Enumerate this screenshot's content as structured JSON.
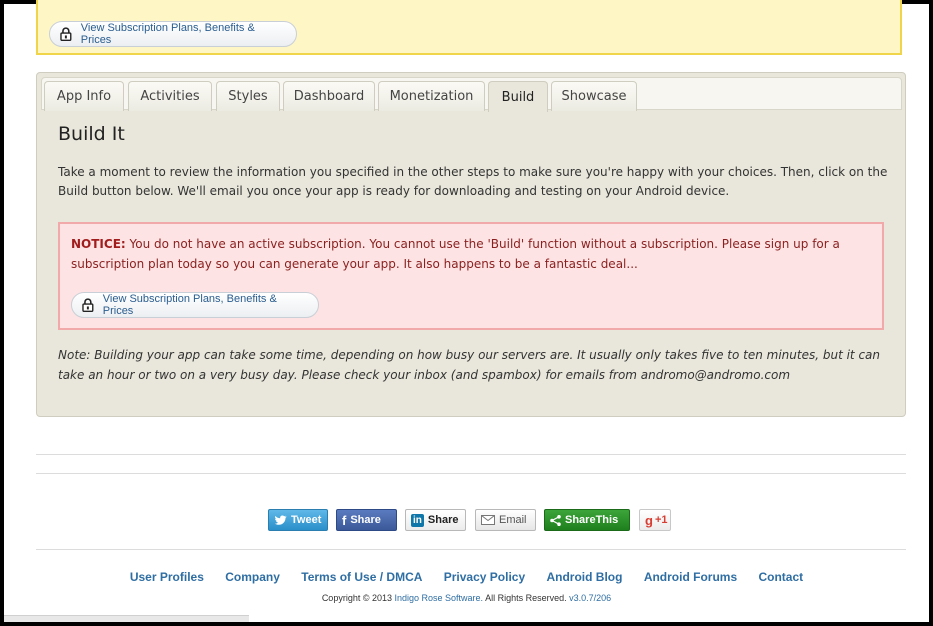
{
  "top_notice": {
    "subscription_button": "View Subscription Plans, Benefits & Prices"
  },
  "tabs": [
    {
      "label": "App Info"
    },
    {
      "label": "Activities"
    },
    {
      "label": "Styles"
    },
    {
      "label": "Dashboard"
    },
    {
      "label": "Monetization"
    },
    {
      "label": "Build",
      "active": true
    },
    {
      "label": "Showcase"
    }
  ],
  "build": {
    "title": "Build It",
    "intro": "Take a moment to review the information you specified in the other steps to make sure you're happy with your choices. Then, click on the Build button below. We'll email you once your app is ready for downloading and testing on your Android device.",
    "notice_label": "NOTICE:",
    "notice_text": " You do not have an active subscription. You cannot use the 'Build' function without a subscription. Please sign up for a subscription plan today so you can generate your app. It also happens to be a fantastic deal...",
    "subscription_button": "View Subscription Plans, Benefits & Prices",
    "note": "Note: Building your app can take some time, depending on how busy our servers are. It usually only takes five to ten minutes, but it can take an hour or two on a very busy day. Please check your inbox (and spambox) for emails from andromo@andromo.com"
  },
  "share": {
    "tweet": "Tweet",
    "facebook": "Share",
    "linkedin": "Share",
    "email": "Email",
    "sharethis": "ShareThis",
    "gplus": "+1"
  },
  "footer": {
    "links": [
      "User Profiles",
      "Company",
      "Terms of Use / DMCA",
      "Privacy Policy",
      "Android Blog",
      "Android Forums",
      "Contact"
    ],
    "copyright_prefix": "Copyright © 2013",
    "company": "Indigo Rose Software.",
    "rights": "All Rights Reserved.",
    "version": "v3.0.7/206"
  },
  "colors": {
    "notice_bg": "#fde3e3",
    "link": "#2f6ea3",
    "panel_bg": "#e9e7db"
  }
}
